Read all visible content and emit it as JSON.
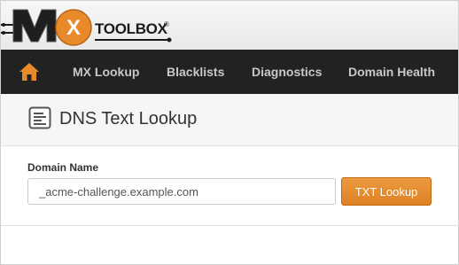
{
  "header": {
    "logo_text": "MX TOOLBOX",
    "brand_word": "TOOLBOX",
    "registered_mark": "®"
  },
  "nav": {
    "home_icon": "home-icon",
    "items": [
      {
        "label": "MX Lookup"
      },
      {
        "label": "Blacklists"
      },
      {
        "label": "Diagnostics"
      },
      {
        "label": "Domain Health"
      }
    ]
  },
  "page": {
    "title": "DNS Text Lookup",
    "title_icon": "document-icon"
  },
  "form": {
    "domain_label": "Domain Name",
    "domain_value": "_acme-challenge.example.com",
    "submit_label": "TXT Lookup"
  },
  "colors": {
    "brand_orange": "#E8892A",
    "nav_background": "#222222",
    "nav_text": "#C8C8C8"
  }
}
